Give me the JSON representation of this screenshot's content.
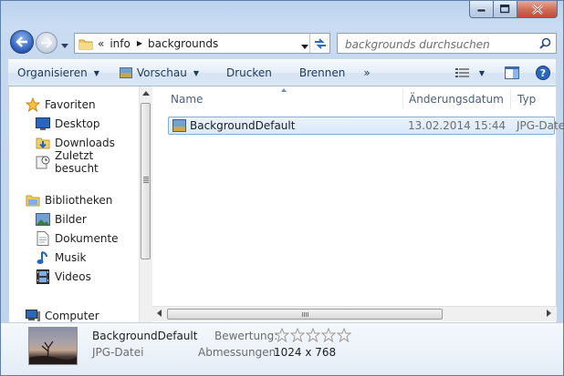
{
  "window": {
    "title_buttons": [
      "minimize-icon",
      "maximize-icon",
      "close-icon"
    ]
  },
  "address": {
    "overflow_glyph": "«",
    "crumbs": [
      "info",
      "backgrounds"
    ]
  },
  "search": {
    "placeholder": "backgrounds durchsuchen"
  },
  "toolbar": {
    "organize": "Organisieren",
    "preview": "Vorschau",
    "print": "Drucken",
    "burn": "Brennen",
    "more": "»"
  },
  "nav": {
    "favorites": "Favoriten",
    "desktop": "Desktop",
    "downloads": "Downloads",
    "recent": "Zuletzt besucht",
    "libraries": "Bibliotheken",
    "pictures": "Bilder",
    "documents": "Dokumente",
    "music": "Musik",
    "videos": "Videos",
    "computer": "Computer"
  },
  "columns": {
    "name": "Name",
    "date": "Änderungsdatum",
    "type": "Typ"
  },
  "files": [
    {
      "name": "BackgroundDefault",
      "date": "13.02.2014 15:44",
      "type": "JPG-Datei"
    }
  ],
  "details": {
    "name": "BackgroundDefault",
    "type": "JPG-Datei",
    "rating_label": "Bewertung:",
    "rating_stars": 0,
    "rating_max": 5,
    "dims_label": "Abmessungen:",
    "dims_value": "1024 x 768"
  },
  "colors": {
    "accent": "#2a5cb6",
    "selection": "#d9e9fc",
    "selection_border": "#84acdd"
  }
}
